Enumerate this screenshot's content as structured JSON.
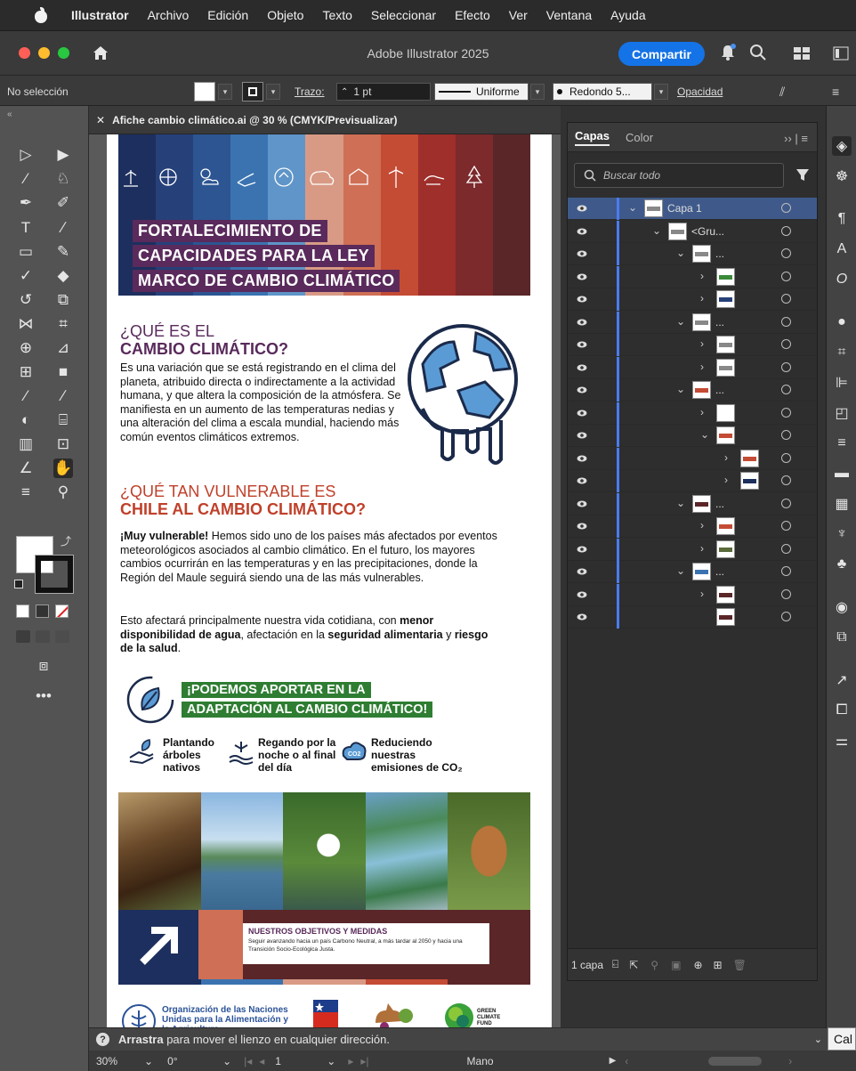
{
  "menubar": {
    "items": [
      "Illustrator",
      "Archivo",
      "Edición",
      "Objeto",
      "Texto",
      "Seleccionar",
      "Efecto",
      "Ver",
      "Ventana",
      "Ayuda"
    ]
  },
  "titlebar": {
    "title": "Adobe Illustrator 2025",
    "share_label": "Compartir"
  },
  "controlbar": {
    "selection": "No selección",
    "stroke_label": "Trazo:",
    "stroke_value": "1 pt",
    "stroke_profile": "Uniforme",
    "brush": "Redondo 5...",
    "opacity_label": "Opacidad"
  },
  "document": {
    "tab_title": "Afiche cambio climático.ai @ 30 % (CMYK/Previsualizar)"
  },
  "poster": {
    "title_lines": [
      "FORTALECIMIENTO DE",
      "CAPACIDADES PARA LA LEY",
      "MARCO DE CAMBIO CLIMÁTICO"
    ],
    "band_colors": [
      "#1d2f5e",
      "#26407a",
      "#2c5592",
      "#3a73b0",
      "#5f95c8",
      "#d89a85",
      "#cf6f55",
      "#c44b34",
      "#9e2f2b",
      "#7c2a2c",
      "#5a2628"
    ],
    "q1_line1": "¿QUÉ ES EL",
    "q1_line2": "CAMBIO CLIMÁTICO?",
    "q1_text": "Es una variación que se está registrando en el clima del planeta, atribuido directa o indirectamente a la actividad humana, y que altera la composición de la atmósfera. Se manifiesta en un aumento de las temperaturas nedias y una alteración del clima a escala mundial, haciendo más común eventos climáticos extremos.",
    "q2_line1": "¿QUÉ TAN VULNERABLE ES",
    "q2_line2": "CHILE AL CAMBIO CLIMÁTICO?",
    "q2_bold": "¡Muy vulnerable!",
    "q2_text": " Hemos sido uno de los países más afectados por eventos meteorológicos asociados al cambio climático. En el futuro, los mayores cambios ocurrirán en las temperaturas y en las precipitaciones, donde la Región del Maule seguirá siendo una de las más vulnerables.",
    "q3_p1": "Esto afectará principalmente nuestra vida cotidiana, con ",
    "q3_b1": "menor disponibilidad de agua",
    "q3_p2": ", afectación en la ",
    "q3_b2": "seguridad alimentaria",
    "q3_p3": " y ",
    "q3_b3": "riesgo de la salud",
    "q3_p4": ".",
    "green_line1": "¡PODEMOS APORTAR EN LA",
    "green_line2": "ADAPTACIÓN AL CAMBIO CLIMÁTICO!",
    "action1": "Plantando árboles nativos",
    "action2": "Regando por la noche o al final del día",
    "action3": "Reduciendo nuestras emisiones de CO₂",
    "objectives_title": "NUESTROS OBJETIVOS Y MEDIDAS",
    "objectives_text": "Seguir avanzando hacia un país Carbono Neutral, a más tardar al 2050 y hacia una Transición Socio-Ecológica Justa.",
    "logo1": "Organización de las Naciones Unidas para la Alimentación y la Agricultura",
    "logo4": "GREEN CLIMATE FUND"
  },
  "layers_panel": {
    "tab_layers": "Capas",
    "tab_color": "Color",
    "search_placeholder": "Buscar todo",
    "layer1": "Capa 1",
    "group1": "<Gru...",
    "ellipsis": "...",
    "footer_count": "1 capa"
  },
  "hint": {
    "bold": "Arrastra",
    "text": " para mover el lienzo en cualquier dirección."
  },
  "status": {
    "zoom": "30%",
    "rotation": "0°",
    "artboard": "1",
    "tool": "Mano"
  },
  "right_edge_label": "Cal"
}
